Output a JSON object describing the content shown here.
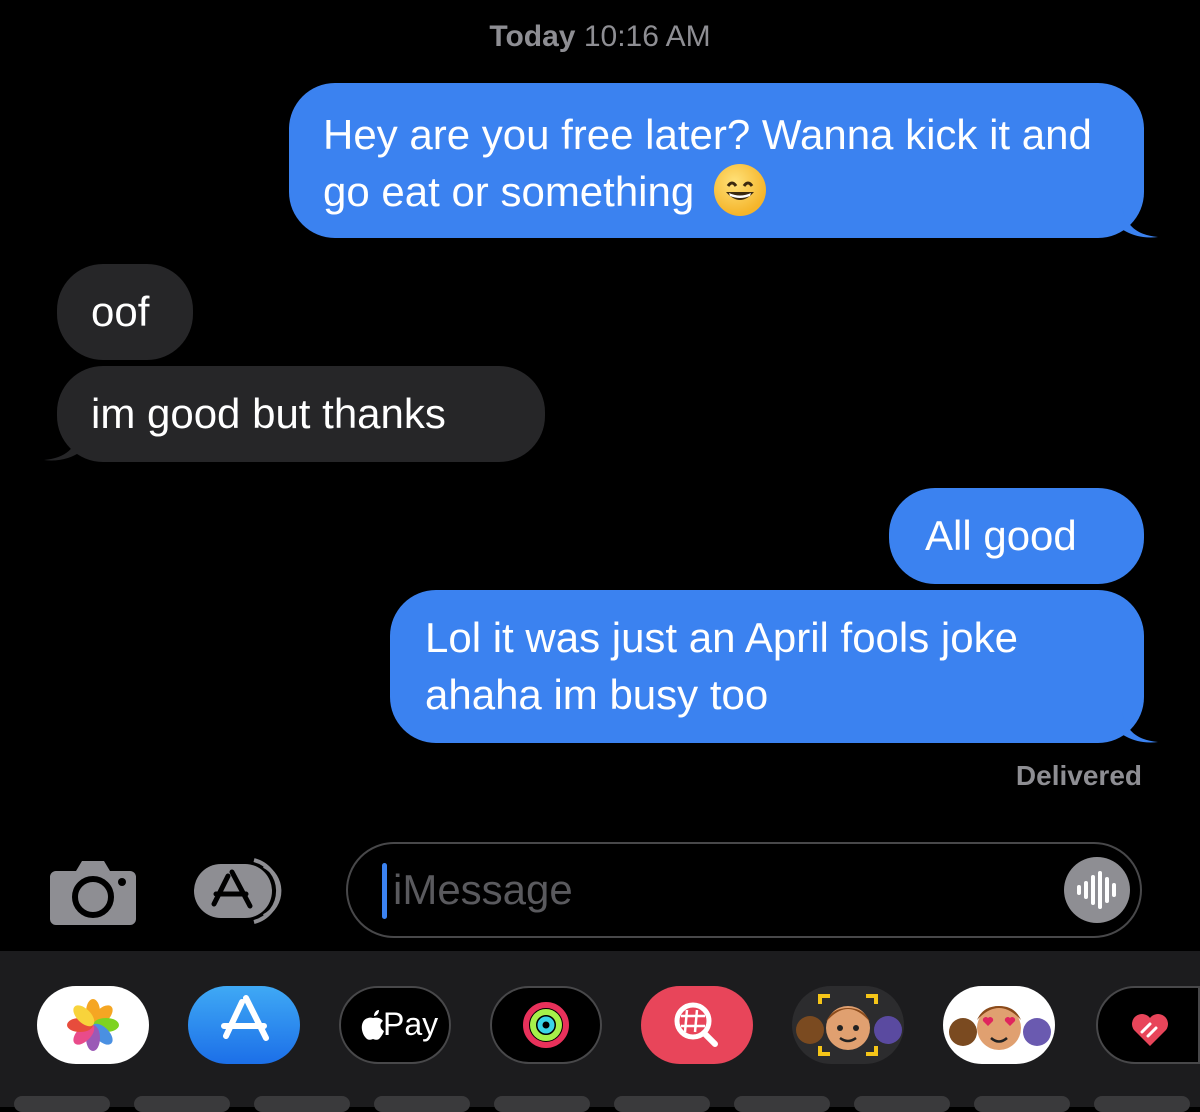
{
  "header": {
    "day": "Today",
    "time": "10:16 AM"
  },
  "messages": [
    {
      "side": "sent",
      "text": "Hey are you free later? Wanna kick it and go eat or something",
      "emoji": "grinning-face"
    },
    {
      "side": "received",
      "text": "oof"
    },
    {
      "side": "received",
      "text": "im good but thanks"
    },
    {
      "side": "sent",
      "text": "All good"
    },
    {
      "side": "sent",
      "text": "Lol it was just an April fools joke ahaha im busy too"
    }
  ],
  "status": "Delivered",
  "compose": {
    "placeholder": "iMessage",
    "camera_icon": "camera-icon",
    "apps_icon": "app-store-icon",
    "audio_icon": "waveform-icon"
  },
  "app_tray": {
    "apps": [
      {
        "name": "photos-icon"
      },
      {
        "name": "app-store-icon"
      },
      {
        "name": "apple-pay-icon",
        "label": "Pay"
      },
      {
        "name": "activity-rings-icon"
      },
      {
        "name": "image-search-icon"
      },
      {
        "name": "memoji-camera-icon"
      },
      {
        "name": "memoji-stickers-icon"
      },
      {
        "name": "digital-touch-icon"
      }
    ]
  },
  "colors": {
    "sent_bubble": "#3b82f0",
    "received_bubble": "#262628",
    "background": "#000000"
  }
}
